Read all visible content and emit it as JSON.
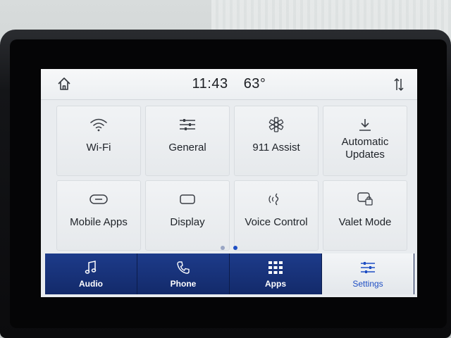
{
  "status": {
    "time": "11:43",
    "temperature": "63°",
    "home_icon": "home-icon",
    "sort_icon": "sort-arrows-icon"
  },
  "tiles": [
    {
      "label": "Wi-Fi",
      "icon": "wifi-icon"
    },
    {
      "label": "General",
      "icon": "sliders-icon"
    },
    {
      "label": "911 Assist",
      "icon": "star-of-life-icon"
    },
    {
      "label": "Automatic Updates",
      "icon": "download-icon"
    },
    {
      "label": "Mobile Apps",
      "icon": "mobile-apps-icon"
    },
    {
      "label": "Display",
      "icon": "display-icon"
    },
    {
      "label": "Voice Control",
      "icon": "voice-icon"
    },
    {
      "label": "Valet Mode",
      "icon": "valet-lock-icon"
    }
  ],
  "pager": {
    "pages": 2,
    "active_page": 2
  },
  "dock": [
    {
      "label": "Audio",
      "icon": "music-note-icon",
      "active": false
    },
    {
      "label": "Phone",
      "icon": "phone-icon",
      "active": false
    },
    {
      "label": "Apps",
      "icon": "apps-grid-icon",
      "active": false
    },
    {
      "label": "Settings",
      "icon": "settings-sliders-icon",
      "active": true
    }
  ],
  "colors": {
    "dock_blue": "#1d3b8a",
    "active_text": "#1f4fc4",
    "tile_bg": "#eceff2"
  }
}
